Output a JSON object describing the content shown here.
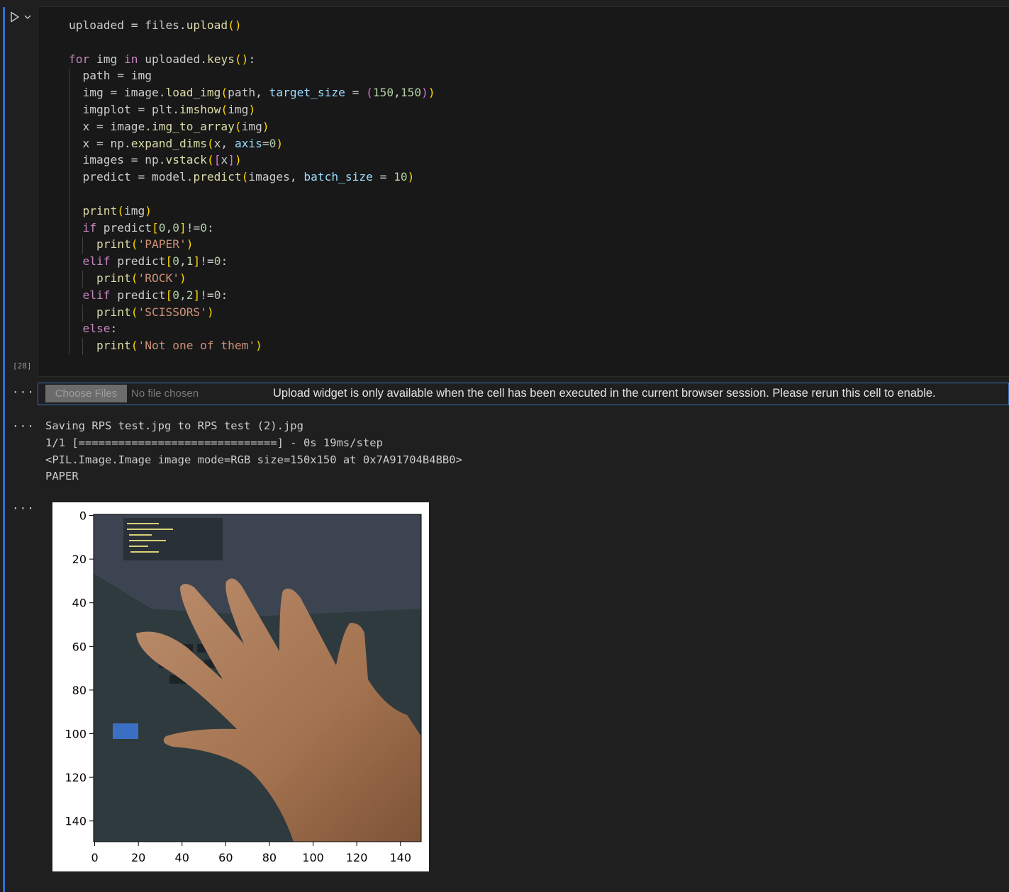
{
  "cell": {
    "execution_count": "[28]",
    "code_lines": [
      {
        "indent": 0,
        "tokens": [
          [
            "",
            "uploaded = files."
          ],
          [
            "fn",
            "upload"
          ],
          [
            "p1",
            "()"
          ]
        ]
      },
      {
        "indent": 0,
        "tokens": []
      },
      {
        "indent": 0,
        "tokens": [
          [
            "ctl",
            "for"
          ],
          [
            "",
            " img "
          ],
          [
            "ctl",
            "in"
          ],
          [
            "",
            " uploaded."
          ],
          [
            "fn",
            "keys"
          ],
          [
            "p1",
            "()"
          ],
          [
            "",
            ":"
          ]
        ]
      },
      {
        "indent": 1,
        "tokens": [
          [
            "",
            "path = img"
          ]
        ]
      },
      {
        "indent": 1,
        "tokens": [
          [
            "",
            "img = image."
          ],
          [
            "fn",
            "load_img"
          ],
          [
            "p1",
            "("
          ],
          [
            "",
            "path, "
          ],
          [
            "var",
            "target_size"
          ],
          [
            "",
            " = "
          ],
          [
            "p2",
            "("
          ],
          [
            "num",
            "150"
          ],
          [
            "",
            ","
          ],
          [
            "num",
            "150"
          ],
          [
            "p2",
            ")"
          ],
          [
            "p1",
            ")"
          ]
        ]
      },
      {
        "indent": 1,
        "tokens": [
          [
            "",
            "imgplot = plt."
          ],
          [
            "fn",
            "imshow"
          ],
          [
            "p1",
            "("
          ],
          [
            "",
            "img"
          ],
          [
            "p1",
            ")"
          ]
        ]
      },
      {
        "indent": 1,
        "tokens": [
          [
            "",
            "x = image."
          ],
          [
            "fn",
            "img_to_array"
          ],
          [
            "p1",
            "("
          ],
          [
            "",
            "img"
          ],
          [
            "p1",
            ")"
          ]
        ]
      },
      {
        "indent": 1,
        "tokens": [
          [
            "",
            "x = np."
          ],
          [
            "fn",
            "expand_dims"
          ],
          [
            "p1",
            "("
          ],
          [
            "",
            "x, "
          ],
          [
            "var",
            "axis"
          ],
          [
            "",
            "="
          ],
          [
            "num",
            "0"
          ],
          [
            "p1",
            ")"
          ]
        ]
      },
      {
        "indent": 1,
        "tokens": [
          [
            "",
            "images = np."
          ],
          [
            "fn",
            "vstack"
          ],
          [
            "p1",
            "("
          ],
          [
            "p2",
            "["
          ],
          [
            "",
            "x"
          ],
          [
            "p2",
            "]"
          ],
          [
            "p1",
            ")"
          ]
        ]
      },
      {
        "indent": 1,
        "tokens": [
          [
            "",
            "predict = model."
          ],
          [
            "fn",
            "predict"
          ],
          [
            "p1",
            "("
          ],
          [
            "",
            "images, "
          ],
          [
            "var",
            "batch_size"
          ],
          [
            "",
            " = "
          ],
          [
            "num",
            "10"
          ],
          [
            "p1",
            ")"
          ]
        ]
      },
      {
        "indent": 0,
        "tokens": []
      },
      {
        "indent": 1,
        "tokens": [
          [
            "fn",
            "print"
          ],
          [
            "p1",
            "("
          ],
          [
            "",
            "img"
          ],
          [
            "p1",
            ")"
          ]
        ]
      },
      {
        "indent": 1,
        "tokens": [
          [
            "ctl",
            "if"
          ],
          [
            "",
            " predict"
          ],
          [
            "p1",
            "["
          ],
          [
            "num",
            "0"
          ],
          [
            "",
            ","
          ],
          [
            "num",
            "0"
          ],
          [
            "p1",
            "]"
          ],
          [
            "",
            "!="
          ],
          [
            "num",
            "0"
          ],
          [
            "",
            ":"
          ]
        ]
      },
      {
        "indent": 2,
        "tokens": [
          [
            "fn",
            "print"
          ],
          [
            "p1",
            "("
          ],
          [
            "str",
            "'PAPER'"
          ],
          [
            "p1",
            ")"
          ]
        ]
      },
      {
        "indent": 1,
        "tokens": [
          [
            "ctl",
            "elif"
          ],
          [
            "",
            " predict"
          ],
          [
            "p1",
            "["
          ],
          [
            "num",
            "0"
          ],
          [
            "",
            ","
          ],
          [
            "num",
            "1"
          ],
          [
            "p1",
            "]"
          ],
          [
            "",
            "!="
          ],
          [
            "num",
            "0"
          ],
          [
            "",
            ":"
          ]
        ]
      },
      {
        "indent": 2,
        "tokens": [
          [
            "fn",
            "print"
          ],
          [
            "p1",
            "("
          ],
          [
            "str",
            "'ROCK'"
          ],
          [
            "p1",
            ")"
          ]
        ]
      },
      {
        "indent": 1,
        "tokens": [
          [
            "ctl",
            "elif"
          ],
          [
            "",
            " predict"
          ],
          [
            "p1",
            "["
          ],
          [
            "num",
            "0"
          ],
          [
            "",
            ","
          ],
          [
            "num",
            "2"
          ],
          [
            "p1",
            "]"
          ],
          [
            "",
            "!="
          ],
          [
            "num",
            "0"
          ],
          [
            "",
            ":"
          ]
        ]
      },
      {
        "indent": 2,
        "tokens": [
          [
            "fn",
            "print"
          ],
          [
            "p1",
            "("
          ],
          [
            "str",
            "'SCISSORS'"
          ],
          [
            "p1",
            ")"
          ]
        ]
      },
      {
        "indent": 1,
        "tokens": [
          [
            "ctl",
            "else"
          ],
          [
            "",
            ":"
          ]
        ]
      },
      {
        "indent": 2,
        "tokens": [
          [
            "fn",
            "print"
          ],
          [
            "p1",
            "("
          ],
          [
            "str",
            "'Not one of them'"
          ],
          [
            "p1",
            ")"
          ]
        ]
      }
    ]
  },
  "outputs": {
    "more_label": "···",
    "upload_widget": {
      "button_label": "Choose Files",
      "file_status": "No file chosen",
      "message": "Upload widget is only available when the cell has been executed in the current browser session. Please rerun this cell to enable."
    },
    "stdout_lines": [
      "Saving RPS test.jpg to RPS test (2).jpg",
      "1/1 [==============================] - 0s 19ms/step",
      "<PIL.Image.Image image mode=RGB size=150x150 at 0x7A91704B4BB0>",
      "PAPER"
    ],
    "plot": {
      "image_description": "hand held open over a laptop keyboard",
      "y_ticks": [
        "0",
        "20",
        "40",
        "60",
        "80",
        "100",
        "120",
        "140"
      ],
      "x_ticks": [
        "0",
        "20",
        "40",
        "60",
        "80",
        "100",
        "120",
        "140"
      ],
      "colors": {
        "screen": "#3c4451",
        "laptop": "#2f3a3e",
        "skin": "#a97a58",
        "background": "#556a6e"
      }
    }
  },
  "icons": {
    "run": "play-icon",
    "expand": "chevron-down-icon"
  }
}
